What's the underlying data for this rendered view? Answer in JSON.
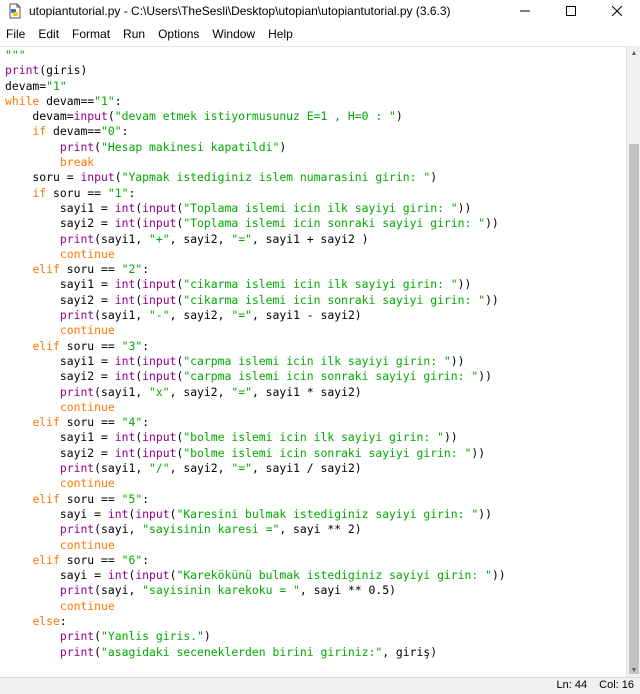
{
  "window": {
    "title": "utopiantutorial.py - C:\\Users\\TheSesli\\Desktop\\utopian\\utopiantutorial.py (3.6.3)",
    "minimize": "—",
    "maximize": "☐",
    "close": "✕"
  },
  "menu": [
    "File",
    "Edit",
    "Format",
    "Run",
    "Options",
    "Window",
    "Help"
  ],
  "status": {
    "line": "Ln: 44",
    "col": "Col: 16"
  },
  "code_lines": [
    [
      [
        "str",
        "\"\"\""
      ]
    ],
    [
      [
        "bi",
        "print"
      ],
      [
        "",
        "(giris)"
      ]
    ],
    [
      [
        "",
        "devam="
      ],
      [
        "str",
        "\"1\""
      ]
    ],
    [
      [
        "kw",
        "while"
      ],
      [
        "",
        " devam=="
      ],
      [
        "str",
        "\"1\""
      ],
      [
        "",
        ":"
      ]
    ],
    [
      [
        "",
        "    devam="
      ],
      [
        "bi",
        "input"
      ],
      [
        "",
        "("
      ],
      [
        "str",
        "\"devam etmek istiyormusunuz E=1 , H=0 : \""
      ],
      [
        "",
        ")"
      ]
    ],
    [
      [
        "",
        "    "
      ],
      [
        "kw",
        "if"
      ],
      [
        "",
        " devam=="
      ],
      [
        "str",
        "\"0\""
      ],
      [
        "",
        ":"
      ]
    ],
    [
      [
        "",
        "        "
      ],
      [
        "bi",
        "print"
      ],
      [
        "",
        "("
      ],
      [
        "str",
        "\"Hesap makinesi kapatildi\""
      ],
      [
        "",
        ")"
      ]
    ],
    [
      [
        "",
        "        "
      ],
      [
        "kw",
        "break"
      ]
    ],
    [
      [
        "",
        "    soru = "
      ],
      [
        "bi",
        "input"
      ],
      [
        "",
        "("
      ],
      [
        "str",
        "\"Yapmak istediginiz islem numarasini girin: \""
      ],
      [
        "",
        ")"
      ]
    ],
    [
      [
        "",
        "    "
      ],
      [
        "kw",
        "if"
      ],
      [
        "",
        " soru == "
      ],
      [
        "str",
        "\"1\""
      ],
      [
        "",
        ":"
      ]
    ],
    [
      [
        "",
        "        sayi1 = "
      ],
      [
        "bi",
        "int"
      ],
      [
        "",
        "("
      ],
      [
        "bi",
        "input"
      ],
      [
        "",
        "("
      ],
      [
        "str",
        "\"Toplama islemi icin ilk sayiyi girin: \""
      ],
      [
        "",
        "))"
      ]
    ],
    [
      [
        "",
        "        sayi2 = "
      ],
      [
        "bi",
        "int"
      ],
      [
        "",
        "("
      ],
      [
        "bi",
        "input"
      ],
      [
        "",
        "("
      ],
      [
        "str",
        "\"Toplama islemi icin sonraki sayiyi girin: \""
      ],
      [
        "",
        "))"
      ]
    ],
    [
      [
        "",
        "        "
      ],
      [
        "bi",
        "print"
      ],
      [
        "",
        "(sayi1, "
      ],
      [
        "str",
        "\"+\""
      ],
      [
        "",
        ", sayi2, "
      ],
      [
        "str",
        "\"=\""
      ],
      [
        "",
        ", sayi1 + sayi2 )"
      ]
    ],
    [
      [
        "",
        "        "
      ],
      [
        "kw",
        "continue"
      ]
    ],
    [
      [
        "",
        "    "
      ],
      [
        "kw",
        "elif"
      ],
      [
        "",
        " soru == "
      ],
      [
        "str",
        "\"2\""
      ],
      [
        "",
        ":"
      ]
    ],
    [
      [
        "",
        "        sayi1 = "
      ],
      [
        "bi",
        "int"
      ],
      [
        "",
        "("
      ],
      [
        "bi",
        "input"
      ],
      [
        "",
        "("
      ],
      [
        "str",
        "\"cikarma islemi icin ilk sayiyi girin: \""
      ],
      [
        "",
        "))"
      ]
    ],
    [
      [
        "",
        "        sayi2 = "
      ],
      [
        "bi",
        "int"
      ],
      [
        "",
        "("
      ],
      [
        "bi",
        "input"
      ],
      [
        "",
        "("
      ],
      [
        "str",
        "\"cikarma islemi icin sonraki sayiyi girin: \""
      ],
      [
        "",
        "))"
      ]
    ],
    [
      [
        "",
        "        "
      ],
      [
        "bi",
        "print"
      ],
      [
        "",
        "(sayi1, "
      ],
      [
        "str",
        "\"-\""
      ],
      [
        "",
        ", sayi2, "
      ],
      [
        "str",
        "\"=\""
      ],
      [
        "",
        ", sayi1 - sayi2)"
      ]
    ],
    [
      [
        "",
        "        "
      ],
      [
        "kw",
        "continue"
      ]
    ],
    [
      [
        "",
        "    "
      ],
      [
        "kw",
        "elif"
      ],
      [
        "",
        " soru == "
      ],
      [
        "str",
        "\"3\""
      ],
      [
        "",
        ":"
      ]
    ],
    [
      [
        "",
        "        sayi1 = "
      ],
      [
        "bi",
        "int"
      ],
      [
        "",
        "("
      ],
      [
        "bi",
        "input"
      ],
      [
        "",
        "("
      ],
      [
        "str",
        "\"carpma islemi icin ilk sayiyi girin: \""
      ],
      [
        "",
        "))"
      ]
    ],
    [
      [
        "",
        "        sayi2 = "
      ],
      [
        "bi",
        "int"
      ],
      [
        "",
        "("
      ],
      [
        "bi",
        "input"
      ],
      [
        "",
        "("
      ],
      [
        "str",
        "\"carpma islemi icin sonraki sayiyi girin: \""
      ],
      [
        "",
        "))"
      ]
    ],
    [
      [
        "",
        "        "
      ],
      [
        "bi",
        "print"
      ],
      [
        "",
        "(sayi1, "
      ],
      [
        "str",
        "\"x\""
      ],
      [
        "",
        ", sayi2, "
      ],
      [
        "str",
        "\"=\""
      ],
      [
        "",
        ", sayi1 * sayi2)"
      ]
    ],
    [
      [
        "",
        "        "
      ],
      [
        "kw",
        "continue"
      ]
    ],
    [
      [
        "",
        "    "
      ],
      [
        "kw",
        "elif"
      ],
      [
        "",
        " soru == "
      ],
      [
        "str",
        "\"4\""
      ],
      [
        "",
        ":"
      ]
    ],
    [
      [
        "",
        "        sayi1 = "
      ],
      [
        "bi",
        "int"
      ],
      [
        "",
        "("
      ],
      [
        "bi",
        "input"
      ],
      [
        "",
        "("
      ],
      [
        "str",
        "\"bolme islemi icin ilk sayiyi girin: \""
      ],
      [
        "",
        "))"
      ]
    ],
    [
      [
        "",
        "        sayi2 = "
      ],
      [
        "bi",
        "int"
      ],
      [
        "",
        "("
      ],
      [
        "bi",
        "input"
      ],
      [
        "",
        "("
      ],
      [
        "str",
        "\"bolme islemi icin sonraki sayiyi girin: \""
      ],
      [
        "",
        "))"
      ]
    ],
    [
      [
        "",
        "        "
      ],
      [
        "bi",
        "print"
      ],
      [
        "",
        "(sayi1, "
      ],
      [
        "str",
        "\"/\""
      ],
      [
        "",
        ", sayi2, "
      ],
      [
        "str",
        "\"=\""
      ],
      [
        "",
        ", sayi1 / sayi2)"
      ]
    ],
    [
      [
        "",
        "        "
      ],
      [
        "kw",
        "continue"
      ]
    ],
    [
      [
        "",
        "    "
      ],
      [
        "kw",
        "elif"
      ],
      [
        "",
        " soru == "
      ],
      [
        "str",
        "\"5\""
      ],
      [
        "",
        ":"
      ]
    ],
    [
      [
        "",
        "        sayi = "
      ],
      [
        "bi",
        "int"
      ],
      [
        "",
        "("
      ],
      [
        "bi",
        "input"
      ],
      [
        "",
        "("
      ],
      [
        "str",
        "\"Karesini bulmak istediginiz sayiyi girin: \""
      ],
      [
        "",
        "))"
      ]
    ],
    [
      [
        "",
        "        "
      ],
      [
        "bi",
        "print"
      ],
      [
        "",
        "(sayi, "
      ],
      [
        "str",
        "\"sayisinin karesi =\""
      ],
      [
        "",
        ", sayi ** 2)"
      ]
    ],
    [
      [
        "",
        "        "
      ],
      [
        "kw",
        "continue"
      ]
    ],
    [
      [
        "",
        "    "
      ],
      [
        "kw",
        "elif"
      ],
      [
        "",
        " soru == "
      ],
      [
        "str",
        "\"6\""
      ],
      [
        "",
        ":"
      ]
    ],
    [
      [
        "",
        "        sayi = "
      ],
      [
        "bi",
        "int"
      ],
      [
        "",
        "("
      ],
      [
        "bi",
        "input"
      ],
      [
        "",
        "("
      ],
      [
        "str",
        "\"Karekökünü bulmak istediginiz sayiyi girin: \""
      ],
      [
        "",
        "))"
      ]
    ],
    [
      [
        "",
        "        "
      ],
      [
        "bi",
        "print"
      ],
      [
        "",
        "(sayi, "
      ],
      [
        "str",
        "\"sayisinin karekoku = \""
      ],
      [
        "",
        ", sayi ** 0.5)"
      ]
    ],
    [
      [
        "",
        "        "
      ],
      [
        "kw",
        "continue"
      ]
    ],
    [
      [
        "",
        "    "
      ],
      [
        "kw",
        "else"
      ],
      [
        "",
        ":"
      ]
    ],
    [
      [
        "",
        "        "
      ],
      [
        "bi",
        "print"
      ],
      [
        "",
        "("
      ],
      [
        "str",
        "\"Yanlis giris.\""
      ],
      [
        "",
        ")"
      ]
    ],
    [
      [
        "",
        "        "
      ],
      [
        "bi",
        "print"
      ],
      [
        "",
        "("
      ],
      [
        "str",
        "\"asagidaki seceneklerden birini giriniz:\""
      ],
      [
        "",
        ", giriş)"
      ]
    ]
  ],
  "colors": {
    "keyword": "#ff7700",
    "builtin": "#900090",
    "string": "#00aa00"
  }
}
